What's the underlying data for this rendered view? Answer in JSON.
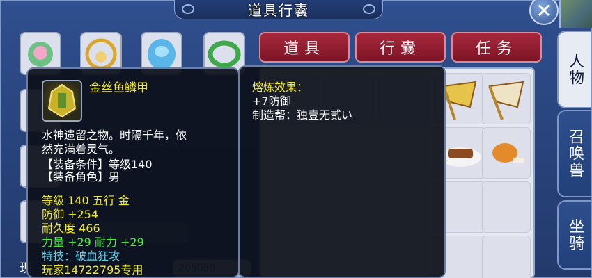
{
  "window": {
    "title": "道具行囊"
  },
  "top_tabs": [
    {
      "label": "道具"
    },
    {
      "label": "行囊"
    },
    {
      "label": "任务"
    }
  ],
  "side_tabs": [
    {
      "label": "人物",
      "active": true
    },
    {
      "label": "召唤兽",
      "active": false
    },
    {
      "label": "坐骑",
      "active": false
    }
  ],
  "item_tooltip": {
    "name": "金丝鱼鳞甲",
    "description_line1": "水神遗留之物。时隔千年，依",
    "description_line2": "然充满着灵气。",
    "requirement_level": "【装备条件】等级140",
    "requirement_role": "【装备角色】男",
    "level_element": "等级 140  五行 金",
    "defense": "防御 +254",
    "durability": "耐久度 466",
    "stats": "力量 +29 耐力 +29",
    "special_skill": "特技：破血狂攻",
    "owner": "玩家14722795专用"
  },
  "smelt_tooltip": {
    "heading": "熔炼效果：",
    "bonus": "+7防御",
    "maker": "制造帮：独壹无贰い"
  },
  "bottom": {
    "left_char": "现",
    "field_value": "205050"
  },
  "colors": {
    "tooltip_yellow": "#f2ea2a",
    "tooltip_green": "#4af23a",
    "tooltip_cyan": "#5fd6f0",
    "tab_red": "#a8283c"
  }
}
